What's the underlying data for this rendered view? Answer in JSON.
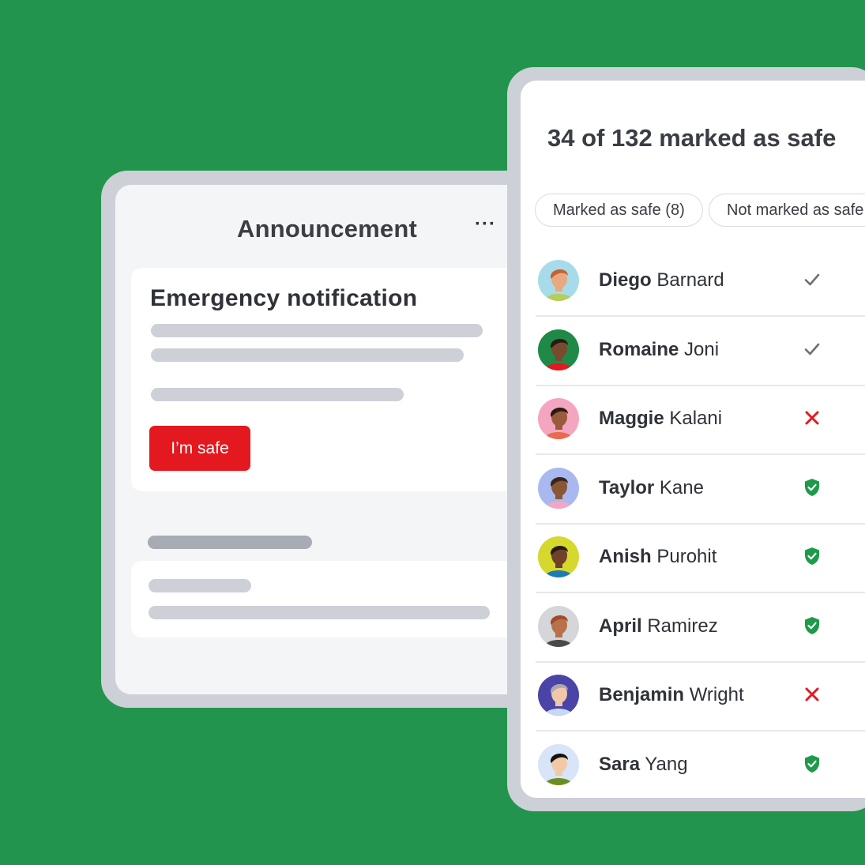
{
  "announcement": {
    "title": "Announcement",
    "menu_glyph": "···",
    "notification": {
      "title": "Emergency notification",
      "button_label": "I’m safe",
      "button_color": "#e3191f"
    }
  },
  "safety_list": {
    "header": "34 of 132 marked as safe",
    "filters": [
      {
        "label": "Marked as safe (8)"
      },
      {
        "label": "Not marked as safe"
      }
    ],
    "people": [
      {
        "first": "Diego",
        "last": "Barnard",
        "status": "check",
        "avatar_bg": "#a8dbe9"
      },
      {
        "first": "Romaine",
        "last": "Joni",
        "status": "check",
        "avatar_bg": "#1f8a47"
      },
      {
        "first": "Maggie",
        "last": "Kalani",
        "status": "cross",
        "avatar_bg": "#f4a6c0"
      },
      {
        "first": "Taylor",
        "last": "Kane",
        "status": "shield",
        "avatar_bg": "#a9b9f0"
      },
      {
        "first": "Anish",
        "last": "Purohit",
        "status": "shield",
        "avatar_bg": "#d6d82e"
      },
      {
        "first": "April",
        "last": "Ramirez",
        "status": "shield",
        "avatar_bg": "#d4d6da"
      },
      {
        "first": "Benjamin",
        "last": "Wright",
        "status": "cross",
        "avatar_bg": "#4b44a8"
      },
      {
        "first": "Sara",
        "last": "Yang",
        "status": "shield",
        "avatar_bg": "#d8e4f7"
      }
    ]
  },
  "colors": {
    "background": "#22944e",
    "check": "#6b6f77",
    "cross": "#e3191f",
    "shield": "#1f9a4a"
  }
}
